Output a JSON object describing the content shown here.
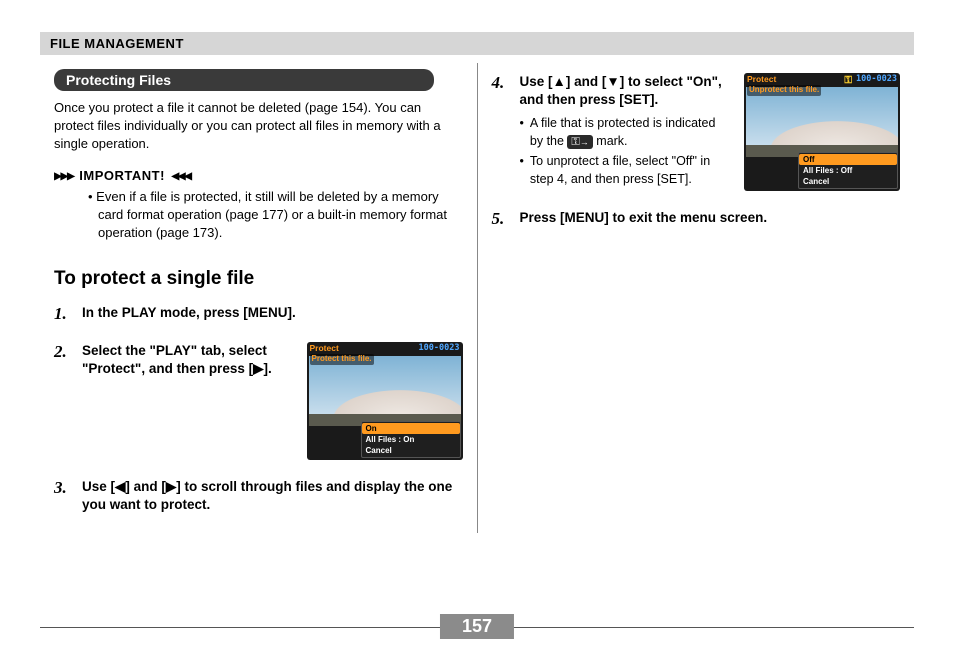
{
  "header": "FILE MANAGEMENT",
  "section_title": "Protecting Files",
  "intro": "Once you protect a file it cannot be deleted (page 154). You can protect files individually or you can protect all files in memory with a single operation.",
  "important": {
    "label": "IMPORTANT!",
    "text": "Even if a file is protected, it still will be deleted by a memory card format operation (page 177) or a built-in memory format operation (page 173)."
  },
  "sub_heading": "To protect a single file",
  "left_steps": {
    "s1": {
      "num": "1.",
      "text": "In the PLAY mode, press [MENU]."
    },
    "s2": {
      "num": "2.",
      "text": "Select the \"PLAY\" tab, select \"Protect\", and then press [▶]."
    },
    "s3": {
      "num": "3.",
      "text": "Use [◀] and [▶] to scroll through files and display the one you want to protect."
    }
  },
  "right_steps": {
    "s4": {
      "num": "4.",
      "text": "Use [▲] and [▼] to select \"On\", and then press [SET].",
      "b1_a": "A file that is protected is indicated by the ",
      "b1_b": " mark.",
      "b2": "To unprotect a file, select \"Off\" in step 4, and then press [SET]."
    },
    "s5": {
      "num": "5.",
      "text": "Press [MENU] to exit the menu screen."
    }
  },
  "lcd1": {
    "top_left": "Protect",
    "top_right": "100-0023",
    "msg": "Protect this file.",
    "menu": {
      "sel": "On",
      "r2": "All Files : On",
      "r3": "Cancel"
    }
  },
  "lcd2": {
    "top_left": "Protect",
    "top_right": "100-0023",
    "msg": "Unprotect this file.",
    "menu": {
      "sel": "Off",
      "r2": "All Files : Off",
      "r3": "Cancel"
    }
  },
  "page_number": "157"
}
